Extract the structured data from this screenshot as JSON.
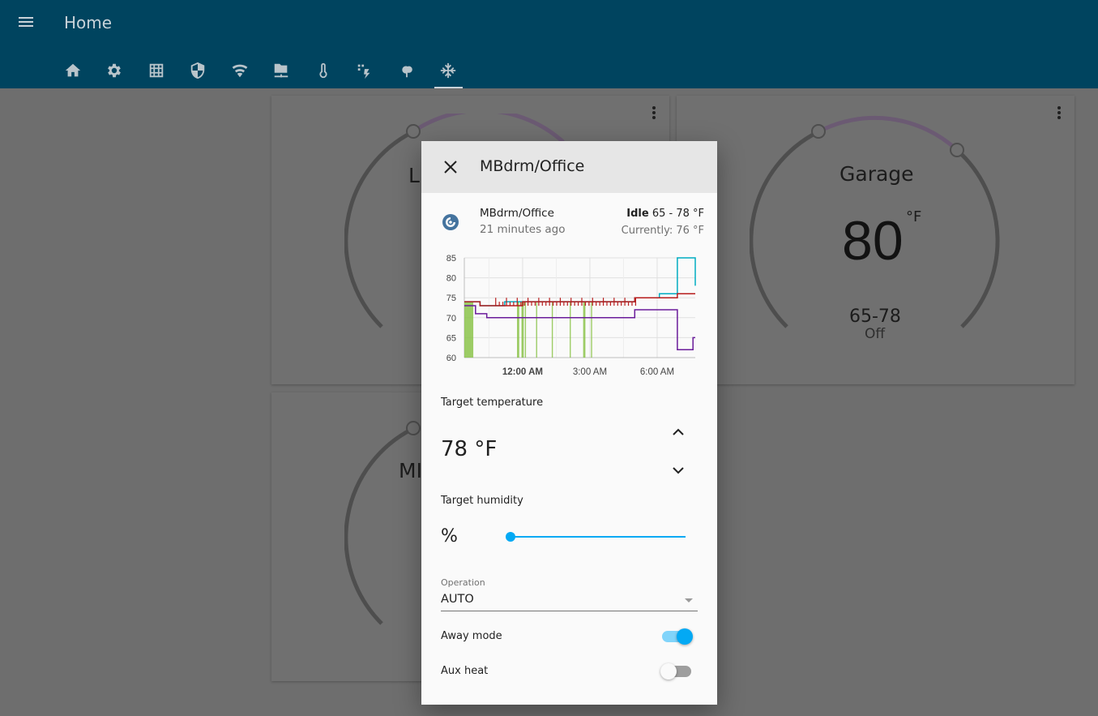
{
  "app": {
    "title": "Home",
    "tabs": [
      {
        "icon": "home-icon",
        "active": false
      },
      {
        "icon": "gear-icon",
        "active": false
      },
      {
        "icon": "grid-icon",
        "active": false
      },
      {
        "icon": "shield-icon",
        "active": false
      },
      {
        "icon": "wifi-icon",
        "active": false
      },
      {
        "icon": "network-folder-icon",
        "active": false
      },
      {
        "icon": "thermometer-icon",
        "active": false
      },
      {
        "icon": "weather-lightning-icon",
        "active": false
      },
      {
        "icon": "tree-icon",
        "active": false
      },
      {
        "icon": "snowflake-icon",
        "active": true
      }
    ]
  },
  "cards": {
    "left_top": {
      "name": "L"
    },
    "left_bottom": {
      "name": "MI"
    },
    "garage": {
      "name": "Garage",
      "temperature": "80",
      "unit": "°F",
      "range": "65-78",
      "mode": "Off"
    }
  },
  "dialog": {
    "title": "MBdrm/Office",
    "entity": {
      "name": "MBdrm/Office",
      "last_changed": "21 minutes ago",
      "state": "Idle",
      "target_range": "65 - 78 °F",
      "current": "Currently: 76 °F"
    },
    "target_temperature_label": "Target temperature",
    "target_temperature": "78 °F",
    "target_humidity_label": "Target humidity",
    "humidity_symbol": "%",
    "humidity_level": 0,
    "operation_label": "Operation",
    "operation_value": "AUTO",
    "away_mode_label": "Away mode",
    "away_mode_on": true,
    "aux_heat_label": "Aux heat",
    "aux_heat_on": false
  },
  "colors": {
    "appbar": "#00445f",
    "accent": "#03a9f4",
    "current_temp_series": "#b71c1c",
    "target_high_series": "#00acc1",
    "target_low_series": "#6a1b9a",
    "heating_fill": "#8bc34a"
  },
  "chart_data": {
    "type": "line",
    "y_ticks": [
      "85",
      "80",
      "75",
      "70",
      "65",
      "60"
    ],
    "ylim": [
      60,
      85
    ],
    "x_ticks": [
      "12:00 AM",
      "3:00 AM",
      "6:00 AM"
    ],
    "x_ticks_bold": [
      true,
      false,
      false
    ],
    "x_range_hours": [
      -2.6,
      7.7
    ],
    "series": [
      {
        "key": "target_high",
        "x": [
          -2.6,
          -1.9,
          -1.9,
          -0.8,
          -0.8,
          5.0,
          5.0,
          6.1,
          6.1,
          6.9,
          6.9,
          7.7,
          7.7
        ],
        "values": [
          74,
          74,
          73,
          73,
          74,
          74,
          75,
          75,
          76,
          76,
          85,
          85,
          78
        ]
      },
      {
        "key": "current_temperature",
        "x": [
          -2.6,
          -1.9,
          -1.9,
          0.0,
          0.0,
          5.0,
          5.0,
          6.9,
          6.9,
          7.7
        ],
        "values": [
          74,
          74,
          73,
          73,
          74,
          74,
          75,
          75,
          76,
          76
        ]
      },
      {
        "key": "target_low",
        "x": [
          -2.6,
          -2.1,
          -2.1,
          -1.6,
          -1.6,
          5.0,
          5.0,
          6.9,
          6.9,
          7.6,
          7.6,
          7.7
        ],
        "values": [
          73,
          73,
          71,
          71,
          70,
          70,
          72,
          72,
          62,
          62,
          65,
          65
        ]
      }
    ],
    "heating_periods": [
      [
        -2.6,
        -2.2
      ],
      [
        -0.25,
        -0.15
      ],
      [
        -0.05,
        0.05
      ],
      [
        0.1,
        0.15
      ],
      [
        0.6,
        0.65
      ],
      [
        1.3,
        1.35
      ],
      [
        2.1,
        2.15
      ],
      [
        2.7,
        2.8
      ],
      [
        3.05,
        3.1
      ]
    ]
  }
}
